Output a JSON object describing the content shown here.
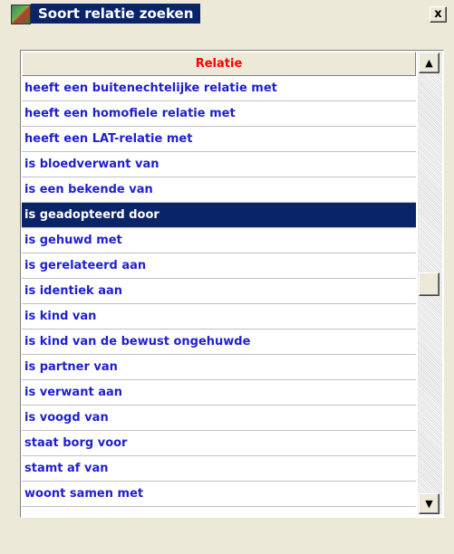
{
  "window": {
    "title": "Soort relatie zoeken",
    "close_label": "x"
  },
  "list": {
    "column_header": "Relatie",
    "selected_index": 5,
    "items": [
      "heeft een buitenechtelijke relatie met",
      "heeft een homofiele relatie met",
      "heeft een LAT-relatie met",
      "is bloedverwant van",
      "is een bekende van",
      "is geadopteerd door",
      "is gehuwd met",
      "is gerelateerd aan",
      "is identiek aan",
      "is kind van",
      "is kind van de bewust ongehuwde",
      "is partner van",
      "is verwant aan",
      "is voogd van",
      "staat borg voor",
      "stamt af van",
      "woont samen met"
    ]
  },
  "scrollbar": {
    "up_icon": "scroll-up-arrow-icon",
    "down_icon": "scroll-down-arrow-icon"
  },
  "colors": {
    "header_text": "#ff0000",
    "item_text": "#1f1fd0",
    "selection_bg": "#0a246a",
    "selection_text": "#ffffff"
  }
}
